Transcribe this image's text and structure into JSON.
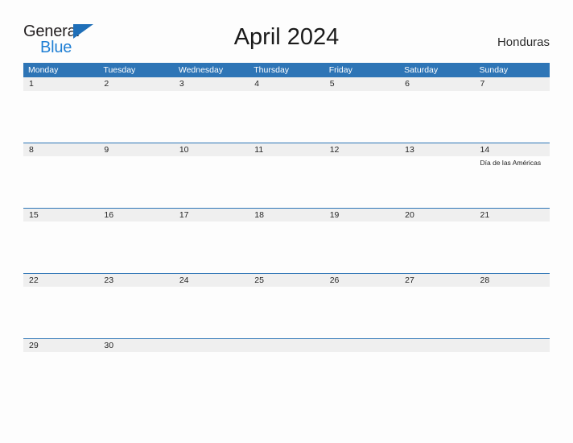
{
  "brand": {
    "name_line1": "General",
    "name_line2": "Blue",
    "triangle_color": "#1f6fb8",
    "line1_color": "#231f20",
    "line2_color": "#1f7fd4"
  },
  "header": {
    "title": "April 2024",
    "country": "Honduras"
  },
  "theme": {
    "header_blue": "#2e75b6",
    "band_gray": "#efefef",
    "page_background": "#fdfdfd",
    "text_color": "#252525"
  },
  "calendar": {
    "weekdays": [
      "Monday",
      "Tuesday",
      "Wednesday",
      "Thursday",
      "Friday",
      "Saturday",
      "Sunday"
    ],
    "weeks": [
      {
        "days": [
          {
            "number": "1",
            "event": ""
          },
          {
            "number": "2",
            "event": ""
          },
          {
            "number": "3",
            "event": ""
          },
          {
            "number": "4",
            "event": ""
          },
          {
            "number": "5",
            "event": ""
          },
          {
            "number": "6",
            "event": ""
          },
          {
            "number": "7",
            "event": ""
          }
        ]
      },
      {
        "days": [
          {
            "number": "8",
            "event": ""
          },
          {
            "number": "9",
            "event": ""
          },
          {
            "number": "10",
            "event": ""
          },
          {
            "number": "11",
            "event": ""
          },
          {
            "number": "12",
            "event": ""
          },
          {
            "number": "13",
            "event": ""
          },
          {
            "number": "14",
            "event": "Día de las Américas"
          }
        ]
      },
      {
        "days": [
          {
            "number": "15",
            "event": ""
          },
          {
            "number": "16",
            "event": ""
          },
          {
            "number": "17",
            "event": ""
          },
          {
            "number": "18",
            "event": ""
          },
          {
            "number": "19",
            "event": ""
          },
          {
            "number": "20",
            "event": ""
          },
          {
            "number": "21",
            "event": ""
          }
        ]
      },
      {
        "days": [
          {
            "number": "22",
            "event": ""
          },
          {
            "number": "23",
            "event": ""
          },
          {
            "number": "24",
            "event": ""
          },
          {
            "number": "25",
            "event": ""
          },
          {
            "number": "26",
            "event": ""
          },
          {
            "number": "27",
            "event": ""
          },
          {
            "number": "28",
            "event": ""
          }
        ]
      },
      {
        "days": [
          {
            "number": "29",
            "event": ""
          },
          {
            "number": "30",
            "event": ""
          },
          {
            "number": "",
            "event": ""
          },
          {
            "number": "",
            "event": ""
          },
          {
            "number": "",
            "event": ""
          },
          {
            "number": "",
            "event": ""
          },
          {
            "number": "",
            "event": ""
          }
        ]
      }
    ]
  }
}
